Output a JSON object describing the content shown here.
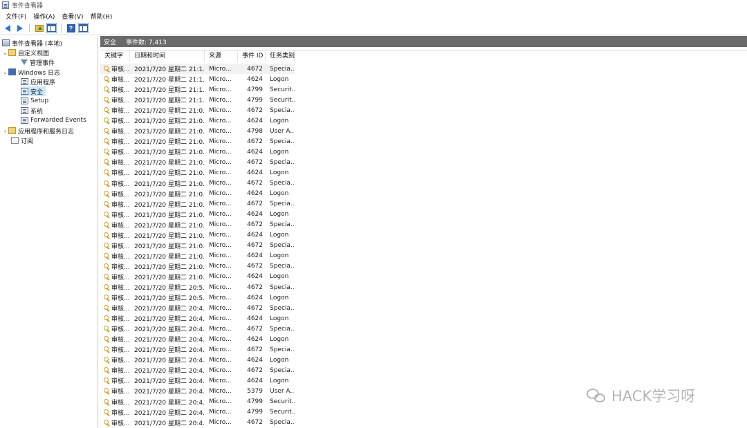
{
  "window": {
    "title": "事件查看器"
  },
  "menu": [
    "文件(F)",
    "操作(A)",
    "查看(V)",
    "帮助(H)"
  ],
  "toolbar": {
    "help_label": "?"
  },
  "tree": {
    "root": "事件查看器 (本地)",
    "custom_views": "自定义视图",
    "admin_events": "管理事件",
    "windows_logs": "Windows 日志",
    "application": "应用程序",
    "security": "安全",
    "setup": "Setup",
    "system": "系统",
    "forwarded": "Forwarded Events",
    "app_services": "应用程序和服务日志",
    "subscriptions": "订阅"
  },
  "main": {
    "log_name": "安全",
    "event_count": "事件数: 7,413"
  },
  "columns": {
    "keyword": "关键字",
    "datetime": "日期和时间",
    "source": "来源",
    "event_id": "事件 ID",
    "task": "任务类别"
  },
  "rows": [
    {
      "k": "审核...",
      "d": "2021/7/20 星期二 21:1...",
      "s": "Micro...",
      "id": "4672",
      "t": "Specia..."
    },
    {
      "k": "审核...",
      "d": "2021/7/20 星期二 21:1...",
      "s": "Micro...",
      "id": "4624",
      "t": "Logon"
    },
    {
      "k": "审核...",
      "d": "2021/7/20 星期二 21:1...",
      "s": "Micro...",
      "id": "4799",
      "t": "Securit..."
    },
    {
      "k": "审核...",
      "d": "2021/7/20 星期二 21:1...",
      "s": "Micro...",
      "id": "4799",
      "t": "Securit..."
    },
    {
      "k": "审核...",
      "d": "2021/7/20 星期二 21:0...",
      "s": "Micro...",
      "id": "4672",
      "t": "Specia..."
    },
    {
      "k": "审核...",
      "d": "2021/7/20 星期二 21:0...",
      "s": "Micro...",
      "id": "4624",
      "t": "Logon"
    },
    {
      "k": "审核...",
      "d": "2021/7/20 星期二 21:0...",
      "s": "Micro...",
      "id": "4798",
      "t": "User A..."
    },
    {
      "k": "审核...",
      "d": "2021/7/20 星期二 21:0...",
      "s": "Micro...",
      "id": "4672",
      "t": "Specia..."
    },
    {
      "k": "审核...",
      "d": "2021/7/20 星期二 21:0...",
      "s": "Micro...",
      "id": "4624",
      "t": "Logon"
    },
    {
      "k": "审核...",
      "d": "2021/7/20 星期二 21:0...",
      "s": "Micro...",
      "id": "4672",
      "t": "Specia..."
    },
    {
      "k": "审核...",
      "d": "2021/7/20 星期二 21:0...",
      "s": "Micro...",
      "id": "4624",
      "t": "Logon"
    },
    {
      "k": "审核...",
      "d": "2021/7/20 星期二 21:0...",
      "s": "Micro...",
      "id": "4672",
      "t": "Specia..."
    },
    {
      "k": "审核...",
      "d": "2021/7/20 星期二 21:0...",
      "s": "Micro...",
      "id": "4624",
      "t": "Logon"
    },
    {
      "k": "审核...",
      "d": "2021/7/20 星期二 21:0...",
      "s": "Micro...",
      "id": "4672",
      "t": "Specia..."
    },
    {
      "k": "审核...",
      "d": "2021/7/20 星期二 21:0...",
      "s": "Micro...",
      "id": "4624",
      "t": "Logon"
    },
    {
      "k": "审核...",
      "d": "2021/7/20 星期二 21:0...",
      "s": "Micro...",
      "id": "4672",
      "t": "Specia..."
    },
    {
      "k": "审核...",
      "d": "2021/7/20 星期二 21:0...",
      "s": "Micro...",
      "id": "4624",
      "t": "Logon"
    },
    {
      "k": "审核...",
      "d": "2021/7/20 星期二 21:0...",
      "s": "Micro...",
      "id": "4672",
      "t": "Specia..."
    },
    {
      "k": "审核...",
      "d": "2021/7/20 星期二 21:0...",
      "s": "Micro...",
      "id": "4624",
      "t": "Logon"
    },
    {
      "k": "审核...",
      "d": "2021/7/20 星期二 21:0...",
      "s": "Micro...",
      "id": "4672",
      "t": "Specia..."
    },
    {
      "k": "审核...",
      "d": "2021/7/20 星期二 21:0...",
      "s": "Micro...",
      "id": "4624",
      "t": "Logon"
    },
    {
      "k": "审核...",
      "d": "2021/7/20 星期二 20:5...",
      "s": "Micro...",
      "id": "4672",
      "t": "Specia..."
    },
    {
      "k": "审核...",
      "d": "2021/7/20 星期二 20:5...",
      "s": "Micro...",
      "id": "4624",
      "t": "Logon"
    },
    {
      "k": "审核...",
      "d": "2021/7/20 星期二 20:4...",
      "s": "Micro...",
      "id": "4672",
      "t": "Specia..."
    },
    {
      "k": "审核...",
      "d": "2021/7/20 星期二 20:4...",
      "s": "Micro...",
      "id": "4624",
      "t": "Logon"
    },
    {
      "k": "审核...",
      "d": "2021/7/20 星期二 20:4...",
      "s": "Micro...",
      "id": "4672",
      "t": "Specia..."
    },
    {
      "k": "审核...",
      "d": "2021/7/20 星期二 20:4...",
      "s": "Micro...",
      "id": "4624",
      "t": "Logon"
    },
    {
      "k": "审核...",
      "d": "2021/7/20 星期二 20:4...",
      "s": "Micro...",
      "id": "4672",
      "t": "Specia..."
    },
    {
      "k": "审核...",
      "d": "2021/7/20 星期二 20:4...",
      "s": "Micro...",
      "id": "4624",
      "t": "Logon"
    },
    {
      "k": "审核...",
      "d": "2021/7/20 星期二 20:4...",
      "s": "Micro...",
      "id": "4672",
      "t": "Specia..."
    },
    {
      "k": "审核...",
      "d": "2021/7/20 星期二 20:4...",
      "s": "Micro...",
      "id": "4624",
      "t": "Logon"
    },
    {
      "k": "审核...",
      "d": "2021/7/20 星期二 20:4...",
      "s": "Micro...",
      "id": "5379",
      "t": "User A..."
    },
    {
      "k": "审核...",
      "d": "2021/7/20 星期二 20:4...",
      "s": "Micro...",
      "id": "4799",
      "t": "Securit..."
    },
    {
      "k": "审核...",
      "d": "2021/7/20 星期二 20:4...",
      "s": "Micro...",
      "id": "4799",
      "t": "Securit..."
    },
    {
      "k": "审核...",
      "d": "2021/7/20 星期二 20:4...",
      "s": "Micro...",
      "id": "4672",
      "t": "Specia..."
    }
  ],
  "watermark": "HACK学习呀",
  "colors": {
    "header_bar": "#6a6a6a",
    "selection": "#cce8ff",
    "accent": "#2b74d6"
  }
}
